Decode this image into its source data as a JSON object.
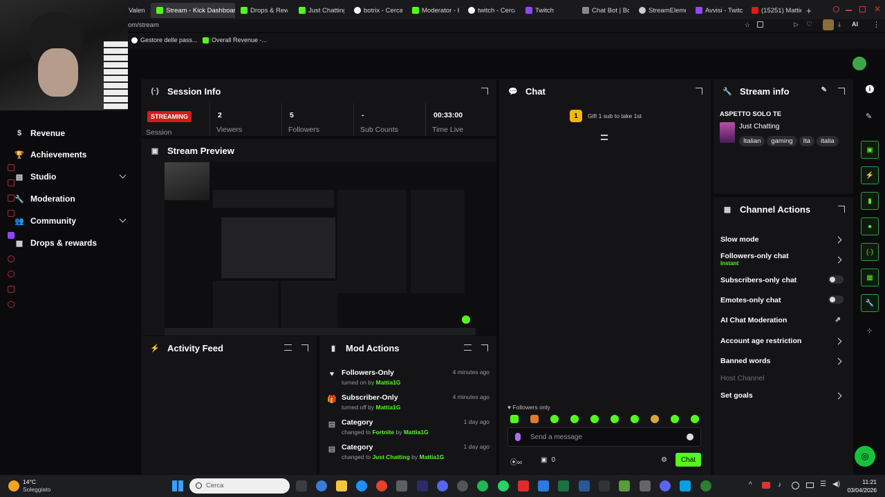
{
  "browser": {
    "tabs": [
      {
        "label": "Valen",
        "icon": "tab-icon"
      },
      {
        "label": "Stream - Kick Dashboard",
        "icon": "kick-icon",
        "active": true
      },
      {
        "label": "Drops & Rewa",
        "icon": "kick-icon"
      },
      {
        "label": "Just Chatting",
        "icon": "kick-icon"
      },
      {
        "label": "botrix - Cerca",
        "icon": "google-icon"
      },
      {
        "label": "Moderator - K",
        "icon": "kick-icon"
      },
      {
        "label": "twitch - Cerca",
        "icon": "google-icon"
      },
      {
        "label": "Twitch",
        "icon": "twitch-icon"
      },
      {
        "label": "Chat Bot | Bo",
        "icon": "tab-icon"
      },
      {
        "label": "StreamEleme",
        "icon": "streamelements-icon"
      },
      {
        "label": "Avvisi - Twitc",
        "icon": "twitch-icon"
      },
      {
        "label": "(15251) Mattie",
        "icon": "youtube-icon"
      }
    ],
    "address": "om/stream",
    "ai_label": "AI",
    "bookmarks": [
      {
        "label": "Gestore delle pass...",
        "icon": "google-icon"
      },
      {
        "label": "Overall Revenue -...",
        "icon": "kick-icon"
      }
    ]
  },
  "sidebar": {
    "items": [
      {
        "label": "Revenue",
        "icon": "revenue-icon"
      },
      {
        "label": "Achievements",
        "icon": "trophy-icon"
      },
      {
        "label": "Studio",
        "icon": "studio-icon",
        "expandable": true
      },
      {
        "label": "Moderation",
        "icon": "wrench-icon"
      },
      {
        "label": "Community",
        "icon": "community-icon",
        "expandable": true
      },
      {
        "label": "Drops & rewards",
        "icon": "drops-icon"
      }
    ]
  },
  "session": {
    "title": "Session Info",
    "status_badge": "STREAMING",
    "session_label": "Session",
    "stats": [
      {
        "value": "2",
        "label": "Viewers"
      },
      {
        "value": "5",
        "label": "Followers"
      },
      {
        "value": "-",
        "label": "Sub Counts"
      },
      {
        "value": "00:33:00",
        "label": "Time Live"
      }
    ]
  },
  "preview": {
    "title": "Stream Preview"
  },
  "activity": {
    "title": "Activity Feed"
  },
  "mod_actions": {
    "title": "Mod Actions",
    "items": [
      {
        "icon": "heart-icon",
        "title": "Followers-Only",
        "action": "turned on by",
        "user": "Mattia1G",
        "time": "4 minutes ago"
      },
      {
        "icon": "gift-icon",
        "title": "Subscriber-Only",
        "action": "turned off by",
        "user": "Mattia1G",
        "time": "4 minutes ago"
      },
      {
        "icon": "category-icon",
        "title": "Category",
        "action": "changed to",
        "target": "Fortnite",
        "by": "by",
        "user": "Mattia1G",
        "time": "1 day ago"
      },
      {
        "icon": "category-icon",
        "title": "Category",
        "action": "changed to",
        "target": "Just Chatting",
        "by": "by",
        "user": "Mattia1G",
        "time": "1 day ago"
      }
    ]
  },
  "chat": {
    "title": "Chat",
    "gift_rank": "1",
    "gift_text": "Gift 1 sub to take 1st",
    "mode_label": "Followers only",
    "placeholder": "Send a message",
    "points": "0",
    "send_label": "Chat"
  },
  "stream_info": {
    "title": "Stream info",
    "stream_title": "ASPETTO SOLO TE",
    "category": "Just Chatting",
    "tags": [
      "Italian",
      "gaming",
      "Ita",
      "italia"
    ]
  },
  "channel_actions": {
    "title": "Channel Actions",
    "items": [
      {
        "label": "Slow mode",
        "control": "arrow"
      },
      {
        "label": "Followers-only chat",
        "sub": "Instant",
        "control": "arrow"
      },
      {
        "label": "Subscribers-only chat",
        "control": "toggle"
      },
      {
        "label": "Emotes-only chat",
        "control": "toggle"
      },
      {
        "label": "AI Chat Moderation",
        "control": "external"
      },
      {
        "label": "Account age restriction",
        "control": "arrow"
      },
      {
        "label": "Banned words",
        "control": "arrow"
      },
      {
        "label": "Host Channel",
        "control": "none",
        "disabled": true
      },
      {
        "label": "Set goals",
        "control": "arrow"
      }
    ]
  },
  "taskbar": {
    "weather_temp": "14°C",
    "weather_desc": "Soleggiato",
    "search_placeholder": "Cerca",
    "time": "11:21",
    "date": "03/04/2026"
  },
  "colors": {
    "accent": "#53fc18",
    "live": "#d31b1b",
    "panel": "#141417",
    "bg": "#0b0b0d"
  }
}
